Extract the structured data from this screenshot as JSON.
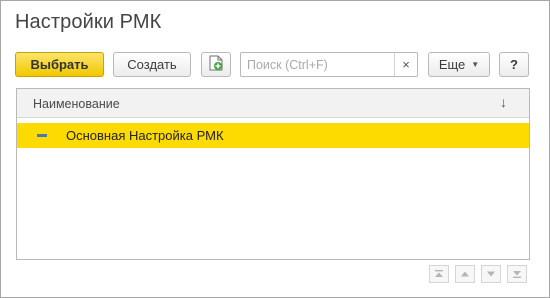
{
  "window": {
    "title": "Настройки РМК"
  },
  "toolbar": {
    "select_label": "Выбрать",
    "create_label": "Создать",
    "copy_icon": "add-document-icon",
    "search": {
      "placeholder": "Поиск (Ctrl+F)",
      "value": "",
      "clear_label": "×"
    },
    "more_label": "Еще",
    "help_label": "?"
  },
  "table": {
    "columns": [
      {
        "label": "Наименование",
        "sort_indicator": "↓"
      }
    ],
    "rows": [
      {
        "name": "Основная Настройка РМК",
        "selected": true
      }
    ]
  },
  "navigation": {
    "icons": [
      "move-to-top-icon",
      "move-up-icon",
      "move-down-icon",
      "move-to-bottom-icon"
    ]
  },
  "colors": {
    "accent_yellow": "#fddb00",
    "primary_button": "#f2c800",
    "marker_blue": "#4a7aa8"
  }
}
